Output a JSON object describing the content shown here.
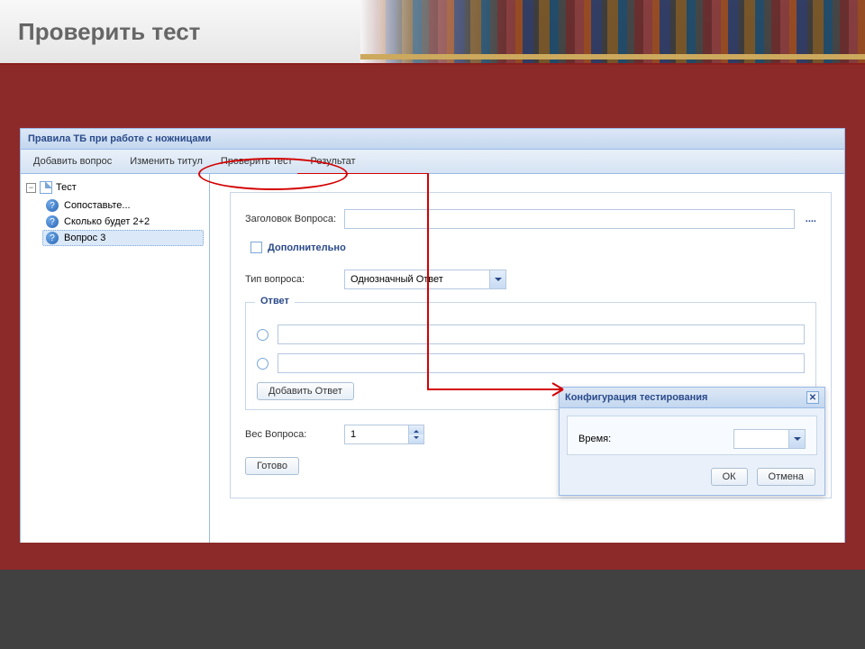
{
  "slide": {
    "title": "Проверить тест"
  },
  "app": {
    "title": "Правила ТБ при работе с ножницами",
    "toolbar": [
      "Добавить вопрос",
      "Изменить титул",
      "Проверить тест",
      "Результат"
    ]
  },
  "tree": {
    "root": "Тест",
    "expanded_glyph": "−",
    "items": [
      {
        "label": "Сопоставьте..."
      },
      {
        "label": "Сколько будет 2+2"
      },
      {
        "label": "Вопрос 3",
        "selected": true
      }
    ],
    "question_glyph": "?"
  },
  "form": {
    "title_label": "Заголовок Вопроса:",
    "title_value": "",
    "ellipsis": "....",
    "extra_checkbox_label": "Дополнительно",
    "type_label": "Тип вопроса:",
    "type_value": "Однозначный Ответ",
    "answer_legend": "Ответ",
    "answers": [
      {
        "value": ""
      },
      {
        "value": ""
      }
    ],
    "add_answer_btn": "Добавить Ответ",
    "weight_label": "Вес Вопроса:",
    "weight_value": "1",
    "done_btn": "Готово"
  },
  "modal": {
    "title": "Конфигурация тестирования",
    "time_label": "Время:",
    "time_value": "",
    "ok": "ОК",
    "cancel": "Отмена"
  }
}
